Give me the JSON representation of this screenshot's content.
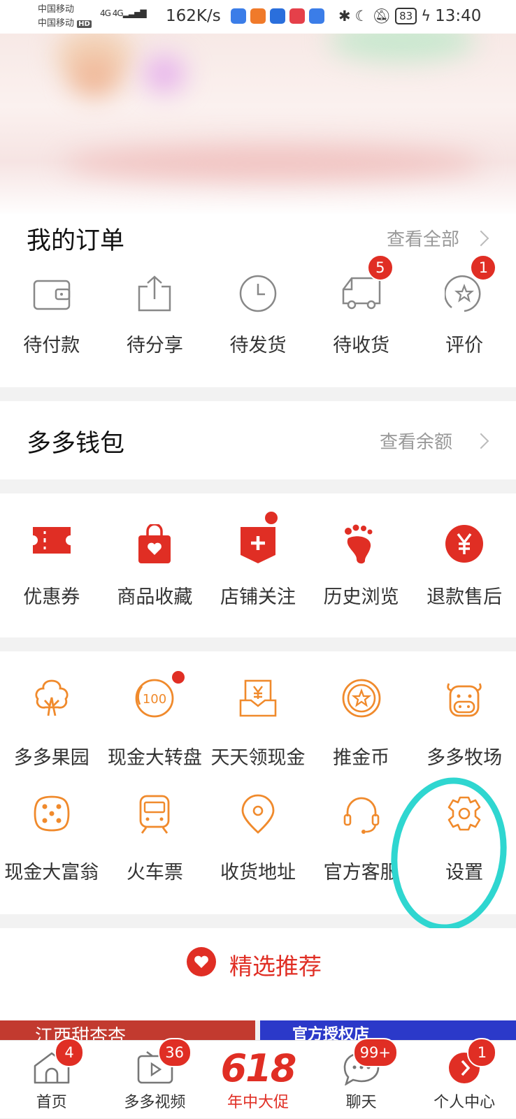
{
  "status_bar": {
    "carrier1": "中国移动",
    "carrier2": "中国移动",
    "hd": "HD",
    "signal": "4G 4G",
    "speed": "162K/s",
    "battery": "83",
    "time": "13:40"
  },
  "colors": {
    "accent": "#e02e24",
    "orange": "#f08a2c",
    "highlight": "#2fd6d0"
  },
  "orders": {
    "title": "我的订单",
    "link": "查看全部",
    "items": [
      {
        "label": "待付款",
        "icon": "wallet-icon"
      },
      {
        "label": "待分享",
        "icon": "share-icon"
      },
      {
        "label": "待发货",
        "icon": "clock-icon"
      },
      {
        "label": "待收货",
        "icon": "truck-icon",
        "badge": "5"
      },
      {
        "label": "评价",
        "icon": "star-comment-icon",
        "badge": "1"
      }
    ]
  },
  "wallet": {
    "title": "多多钱包",
    "link": "查看余额"
  },
  "services": {
    "items": [
      {
        "label": "优惠券",
        "icon": "coupon-icon"
      },
      {
        "label": "商品收藏",
        "icon": "favorite-bag-icon"
      },
      {
        "label": "店铺关注",
        "icon": "store-follow-icon"
      },
      {
        "label": "历史浏览",
        "icon": "footprint-icon"
      },
      {
        "label": "退款售后",
        "icon": "yen-refund-icon"
      }
    ]
  },
  "tools": {
    "row1": [
      {
        "label": "多多果园",
        "icon": "tree-icon"
      },
      {
        "label": "现金大转盘",
        "icon": "wheel-100-icon"
      },
      {
        "label": "天天领现金",
        "icon": "cash-envelope-icon"
      },
      {
        "label": "推金币",
        "icon": "coin-icon"
      },
      {
        "label": "多多牧场",
        "icon": "cow-icon"
      }
    ],
    "row2": [
      {
        "label": "现金大富翁",
        "icon": "dice-icon"
      },
      {
        "label": "火车票",
        "icon": "train-icon"
      },
      {
        "label": "收货地址",
        "icon": "location-pin-icon"
      },
      {
        "label": "官方客服",
        "icon": "headset-icon"
      },
      {
        "label": "设置",
        "icon": "gear-icon"
      }
    ]
  },
  "recommend": {
    "title": "精选推荐"
  },
  "banners": {
    "left": "江西甜杏杏",
    "right": "官方授权店"
  },
  "tabbar": {
    "items": [
      {
        "label": "首页",
        "badge": "4"
      },
      {
        "label": "多多视频",
        "badge": "36"
      },
      {
        "label": "年中大促",
        "logo": "618"
      },
      {
        "label": "聊天",
        "badge": "99+"
      },
      {
        "label": "个人中心",
        "badge": "1"
      }
    ]
  }
}
